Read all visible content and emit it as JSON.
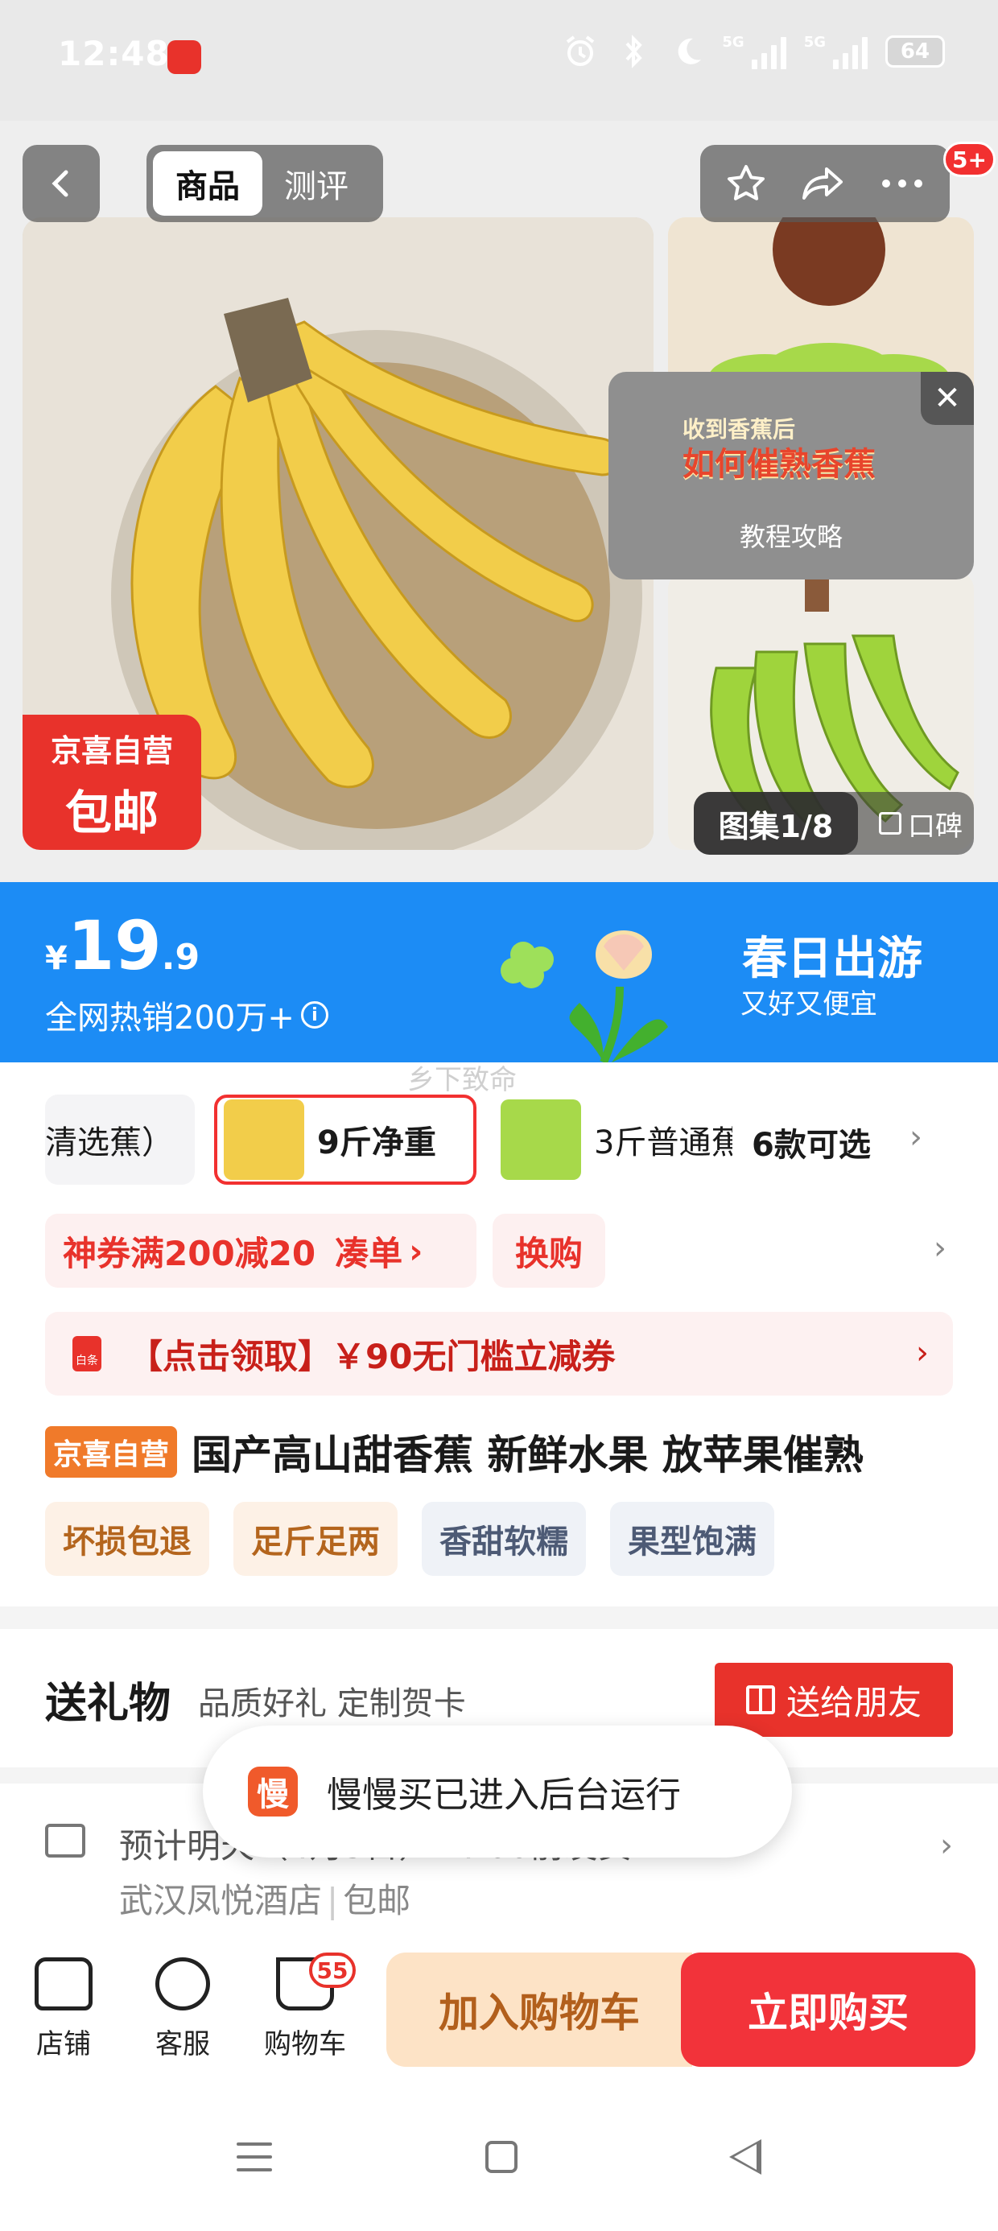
{
  "status_bar": {
    "time": "12:48",
    "network_label": "5G",
    "battery": "64",
    "icons": [
      "app-icon",
      "alarm-icon",
      "bluetooth-icon",
      "moon-icon",
      "signal-icon",
      "signal-icon",
      "battery-icon"
    ]
  },
  "header": {
    "tabs": [
      {
        "label": "商品",
        "active": true
      },
      {
        "label": "测评",
        "active": false
      }
    ],
    "actions": [
      "star-icon",
      "share-icon",
      "more-icon"
    ],
    "notification_badge": "5+"
  },
  "gallery": {
    "promo_badge": {
      "line1": "京喜自营",
      "line2": "包邮"
    },
    "tutorial": {
      "title_small": "收到香蕉后",
      "title_big": "如何催熟香蕉",
      "caption": "教程攻略"
    },
    "counter": "图集1/8",
    "reviews_label": "口碑"
  },
  "price_banner": {
    "currency": "¥",
    "price_int": "19",
    "price_dec": ".9",
    "hot_sales": "全网热销200万+",
    "campaign_title": "春日出游",
    "campaign_subtitle": "又好又便宜",
    "colors": {
      "background": "#1c8cf5"
    }
  },
  "watermark": "乡下致命",
  "variants": {
    "items": [
      {
        "label": "清选蕉）",
        "selected": false
      },
      {
        "label": "9斤净重",
        "selected": true
      },
      {
        "label": "3斤普通蕉",
        "selected": false
      }
    ],
    "count_label": "6款可选"
  },
  "coupons": {
    "coupon_text": "神券满200减20",
    "coupon_action": "凑单",
    "exchange": "换购"
  },
  "claim_bar": {
    "icon_label": "白条",
    "text": "【点击领取】￥90无门槛立减券"
  },
  "product": {
    "self_tag": "京喜自营",
    "title": "国产高山甜香蕉  新鲜水果 放苹果催熟",
    "feature_tags": [
      "坏损包退",
      "足斤足两",
      "香甜软糯",
      "果型饱满"
    ]
  },
  "gift": {
    "title": "送礼物",
    "subtitle": "品质好礼 定制贺卡",
    "button": "送给朋友"
  },
  "delivery": {
    "line1": "预计明天（4月5日）24:00前发货",
    "location": "武汉凤悦酒店",
    "shipping": "包邮"
  },
  "toast": {
    "icon_char": "慢",
    "text": "慢慢买已进入后台运行"
  },
  "bottom_bar": {
    "store": "店铺",
    "service": "客服",
    "cart": "购物车",
    "cart_count": "55",
    "add_to_cart": "加入购物车",
    "buy_now": "立即购买",
    "colors": {
      "add": "#fde3c6",
      "buy": "#f2333a"
    }
  }
}
